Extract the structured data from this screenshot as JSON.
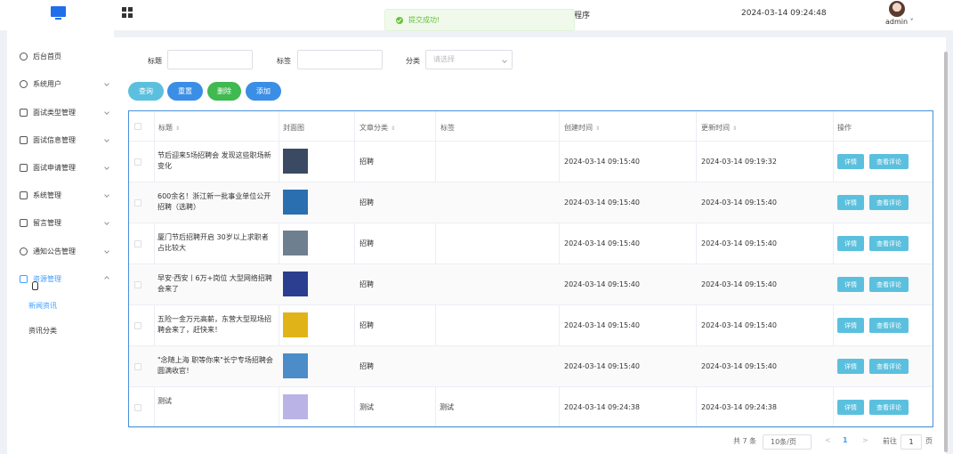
{
  "header": {
    "title_suffix": "程序",
    "datetime": "2024-03-14 09:24:48",
    "user": "admin ˅"
  },
  "toast": {
    "message": "提交成功!"
  },
  "sidebar": {
    "items": [
      {
        "label": "后台首页"
      },
      {
        "label": "系统用户"
      },
      {
        "label": "面试类型管理"
      },
      {
        "label": "面试信息管理"
      },
      {
        "label": "面试申请管理"
      },
      {
        "label": "系统管理"
      },
      {
        "label": "留言管理"
      },
      {
        "label": "通知公告管理"
      },
      {
        "label": "资源管理"
      }
    ],
    "submenu": [
      {
        "label": "新闻资讯"
      },
      {
        "label": "资讯分类"
      }
    ]
  },
  "filters": {
    "title_label": "标题",
    "tag_label": "标签",
    "category_label": "分类",
    "category_placeholder": "请选择"
  },
  "buttons": {
    "search": "查询",
    "reset": "重置",
    "delete": "删除",
    "add": "添加"
  },
  "table": {
    "headers": {
      "title": "标题",
      "cover": "封面图",
      "category": "文章分类",
      "tag": "标签",
      "created": "创建时间",
      "updated": "更新时间",
      "ops": "操作"
    },
    "sort_glyph": "⇕",
    "op_detail": "详情",
    "op_comment": "查看评论",
    "rows": [
      {
        "title": "节后迎来5场招聘会 发现这些职场新变化",
        "category": "招聘",
        "tag": "",
        "created": "2024-03-14 09:15:40",
        "updated": "2024-03-14 09:19:32",
        "thumb": "#3b4a63"
      },
      {
        "title": "600余名！浙江新一批事业单位公开招聘（选聘）",
        "category": "招聘",
        "tag": "",
        "created": "2024-03-14 09:15:40",
        "updated": "2024-03-14 09:15:40",
        "thumb": "#2a6fb0"
      },
      {
        "title": "厦门节后招聘开启 30岁以上求职者占比较大",
        "category": "招聘",
        "tag": "",
        "created": "2024-03-14 09:15:40",
        "updated": "2024-03-14 09:15:40",
        "thumb": "#6e7f8f"
      },
      {
        "title": "早安·西安丨6万+岗位 大型网络招聘会来了",
        "category": "招聘",
        "tag": "",
        "created": "2024-03-14 09:15:40",
        "updated": "2024-03-14 09:15:40",
        "thumb": "#2c3e8f"
      },
      {
        "title": "五险一金万元高薪，东营大型现场招聘会来了，赶快来！",
        "category": "招聘",
        "tag": "",
        "created": "2024-03-14 09:15:40",
        "updated": "2024-03-14 09:15:40",
        "thumb": "#e0b418"
      },
      {
        "title": "\"念随上海 职等你来\"长宁专场招聘会圆满收官！",
        "category": "招聘",
        "tag": "",
        "created": "2024-03-14 09:15:40",
        "updated": "2024-03-14 09:15:40",
        "thumb": "#4c8cc8"
      },
      {
        "title": "测试",
        "category": "测试",
        "tag": "测试",
        "created": "2024-03-14 09:24:38",
        "updated": "2024-03-14 09:24:38",
        "thumb": "#b9b3e6"
      }
    ]
  },
  "pagination": {
    "total": "共 7 条",
    "page_size": "10条/页",
    "prev": "<",
    "page": "1",
    "next": ">",
    "goto": "前往",
    "goto_value": "1",
    "page_unit": "页"
  }
}
